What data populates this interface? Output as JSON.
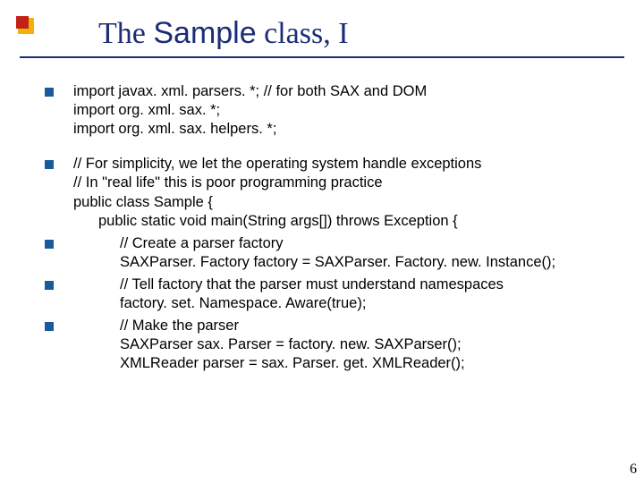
{
  "title": {
    "pre": "The ",
    "mono": "Sample",
    "post": " class, I"
  },
  "bullets": {
    "b1": {
      "l1": "import javax. xml. parsers. *; // for both SAX and DOM",
      "l2": "import org. xml. sax. *;",
      "l3": "import org. xml. sax. helpers. *;"
    },
    "b2": {
      "l1": "// For simplicity, we let the operating system handle exceptions",
      "l2": "// In \"real life\" this is poor programming practice",
      "l3": "public class Sample {",
      "l4": "public static void main(String args[]) throws Exception {"
    },
    "b3": {
      "l1": "// Create a parser factory",
      "l2": "SAXParser. Factory factory = SAXParser. Factory. new. Instance();"
    },
    "b4": {
      "l1": "// Tell factory that the parser must understand namespaces",
      "l2": "factory. set. Namespace. Aware(true);"
    },
    "b5": {
      "l1": "// Make the parser",
      "l2": "SAXParser sax. Parser = factory. new. SAXParser();",
      "l3": "XMLReader parser = sax. Parser. get. XMLReader();"
    }
  },
  "page_number": "6"
}
